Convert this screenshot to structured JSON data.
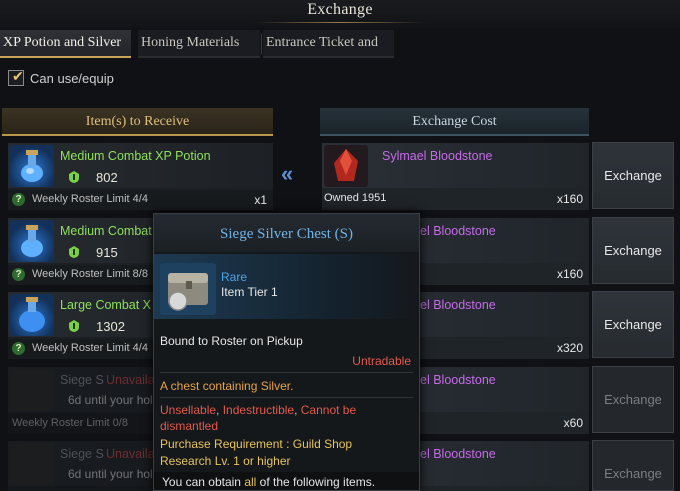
{
  "window": {
    "title": "Exchange"
  },
  "tabs": [
    {
      "label": "XP Potion and Silver",
      "active": true
    },
    {
      "label": "Honing Materials",
      "active": false
    },
    {
      "label": "Entrance Ticket and",
      "active": false
    }
  ],
  "filter": {
    "label": "Can use/equip",
    "checked": true
  },
  "headers": {
    "receive": "Item(s) to Receive",
    "cost": "Exchange Cost"
  },
  "receive_items": [
    {
      "name": "Medium Combat XP Potion",
      "price": "802",
      "limit": "Weekly Roster Limit 4/4",
      "qty": "x1"
    },
    {
      "name": "Medium Combat",
      "price": "915",
      "limit": "Weekly Roster Limit 8/8",
      "qty": ""
    },
    {
      "name": "Large Combat X",
      "price": "1302",
      "limit": "Weekly Roster Limit 4/4",
      "qty": ""
    },
    {
      "name": "Siege S",
      "status": "Unavaila",
      "timer": "6d until your hold",
      "limit": "Weekly Roster Limit 0/8"
    },
    {
      "name": "Siege S",
      "status": "Unavaila",
      "timer": "6d until your hold",
      "limit": ""
    }
  ],
  "cost_items": [
    {
      "name": "Sylmael Bloodstone",
      "owned": "Owned 1951",
      "qty": "x160"
    },
    {
      "name": "el Bloodstone",
      "owned": "",
      "qty": "x160"
    },
    {
      "name": "el Bloodstone",
      "owned": "",
      "qty": "x320"
    },
    {
      "name": "el Bloodstone",
      "owned": "",
      "qty": "x60"
    },
    {
      "name": "el Bloodstone",
      "owned": "",
      "qty": ""
    }
  ],
  "exchange_button": "Exchange",
  "tooltip": {
    "title": "Siege Silver Chest (S)",
    "rarity": "Rare",
    "tier": "Item Tier 1",
    "bound": "Bound to Roster on Pickup",
    "tradable": "Untradable",
    "description": "A chest containing Silver.",
    "flags_1": "Unsellable",
    "flags_2": "Indestructible",
    "flags_3": "Cannot be",
    "flags_4": "dismantled",
    "req_1": "Purchase Requirement : Guild Shop",
    "req_2": "Research Lv. 1 or higher",
    "footer_1": "You can obtain",
    "footer_all": "all",
    "footer_2": "of the following items."
  },
  "colors": {
    "accent_gold": "#c9a45a",
    "item_green": "#8fe05a",
    "epic_purple": "#c66be8",
    "rare_blue": "#4aa6e8"
  }
}
